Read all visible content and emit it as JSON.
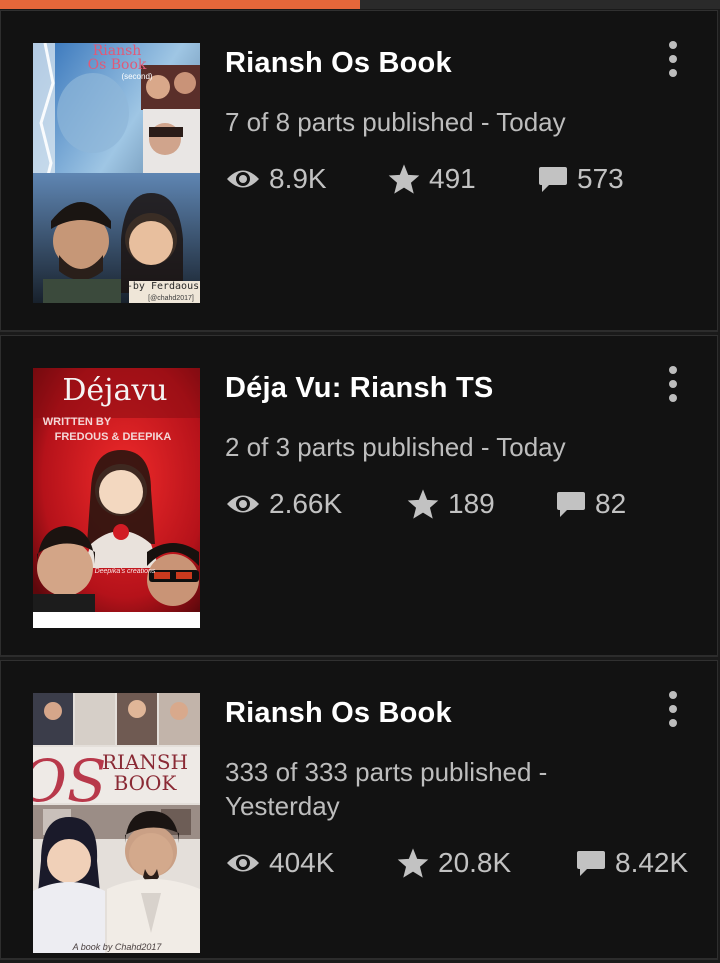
{
  "reading_progress": 0.5,
  "accent_color": "#e5673a",
  "stories": [
    {
      "title": "Riansh Os Book",
      "parts_status": "7 of 8 parts published - Today",
      "reads": "8.9K",
      "votes": "491",
      "comments": "573",
      "cover": {
        "title_line1": "Riansh",
        "title_line2": "Os Book",
        "tagline": "(second)",
        "credit": "-by Ferdaous",
        "handle": "[@chahd2017]",
        "palette": [
          "#cfe3f2",
          "#3e6e9e",
          "#1d2a38",
          "#d9b99a"
        ]
      }
    },
    {
      "title": "Déja Vu: Riansh TS",
      "parts_status": "2 of 3 parts published - Today",
      "reads": "2.66K",
      "votes": "189",
      "comments": "82",
      "cover": {
        "title_line1": "Déjavu",
        "written_by": "WRITTEN BY",
        "authors": "FREDOUS & DEEPIKA",
        "signature": "Deepika's creations",
        "palette": [
          "#c9141c",
          "#6a0a0d",
          "#1d1d1d",
          "#f0d6c0"
        ]
      }
    },
    {
      "title": "Riansh Os Book",
      "parts_status": "333 of 333 parts published - Yesterday",
      "reads": "404K",
      "votes": "20.8K",
      "comments": "8.42K",
      "cover": {
        "title_letters": "OS",
        "title_line1": "RIANSH",
        "title_line2": "BOOK",
        "credit": "A book by Chahd2017",
        "palette": [
          "#e8e3de",
          "#b8aaa4",
          "#3a2f2c",
          "#8a2a35"
        ]
      }
    }
  ]
}
